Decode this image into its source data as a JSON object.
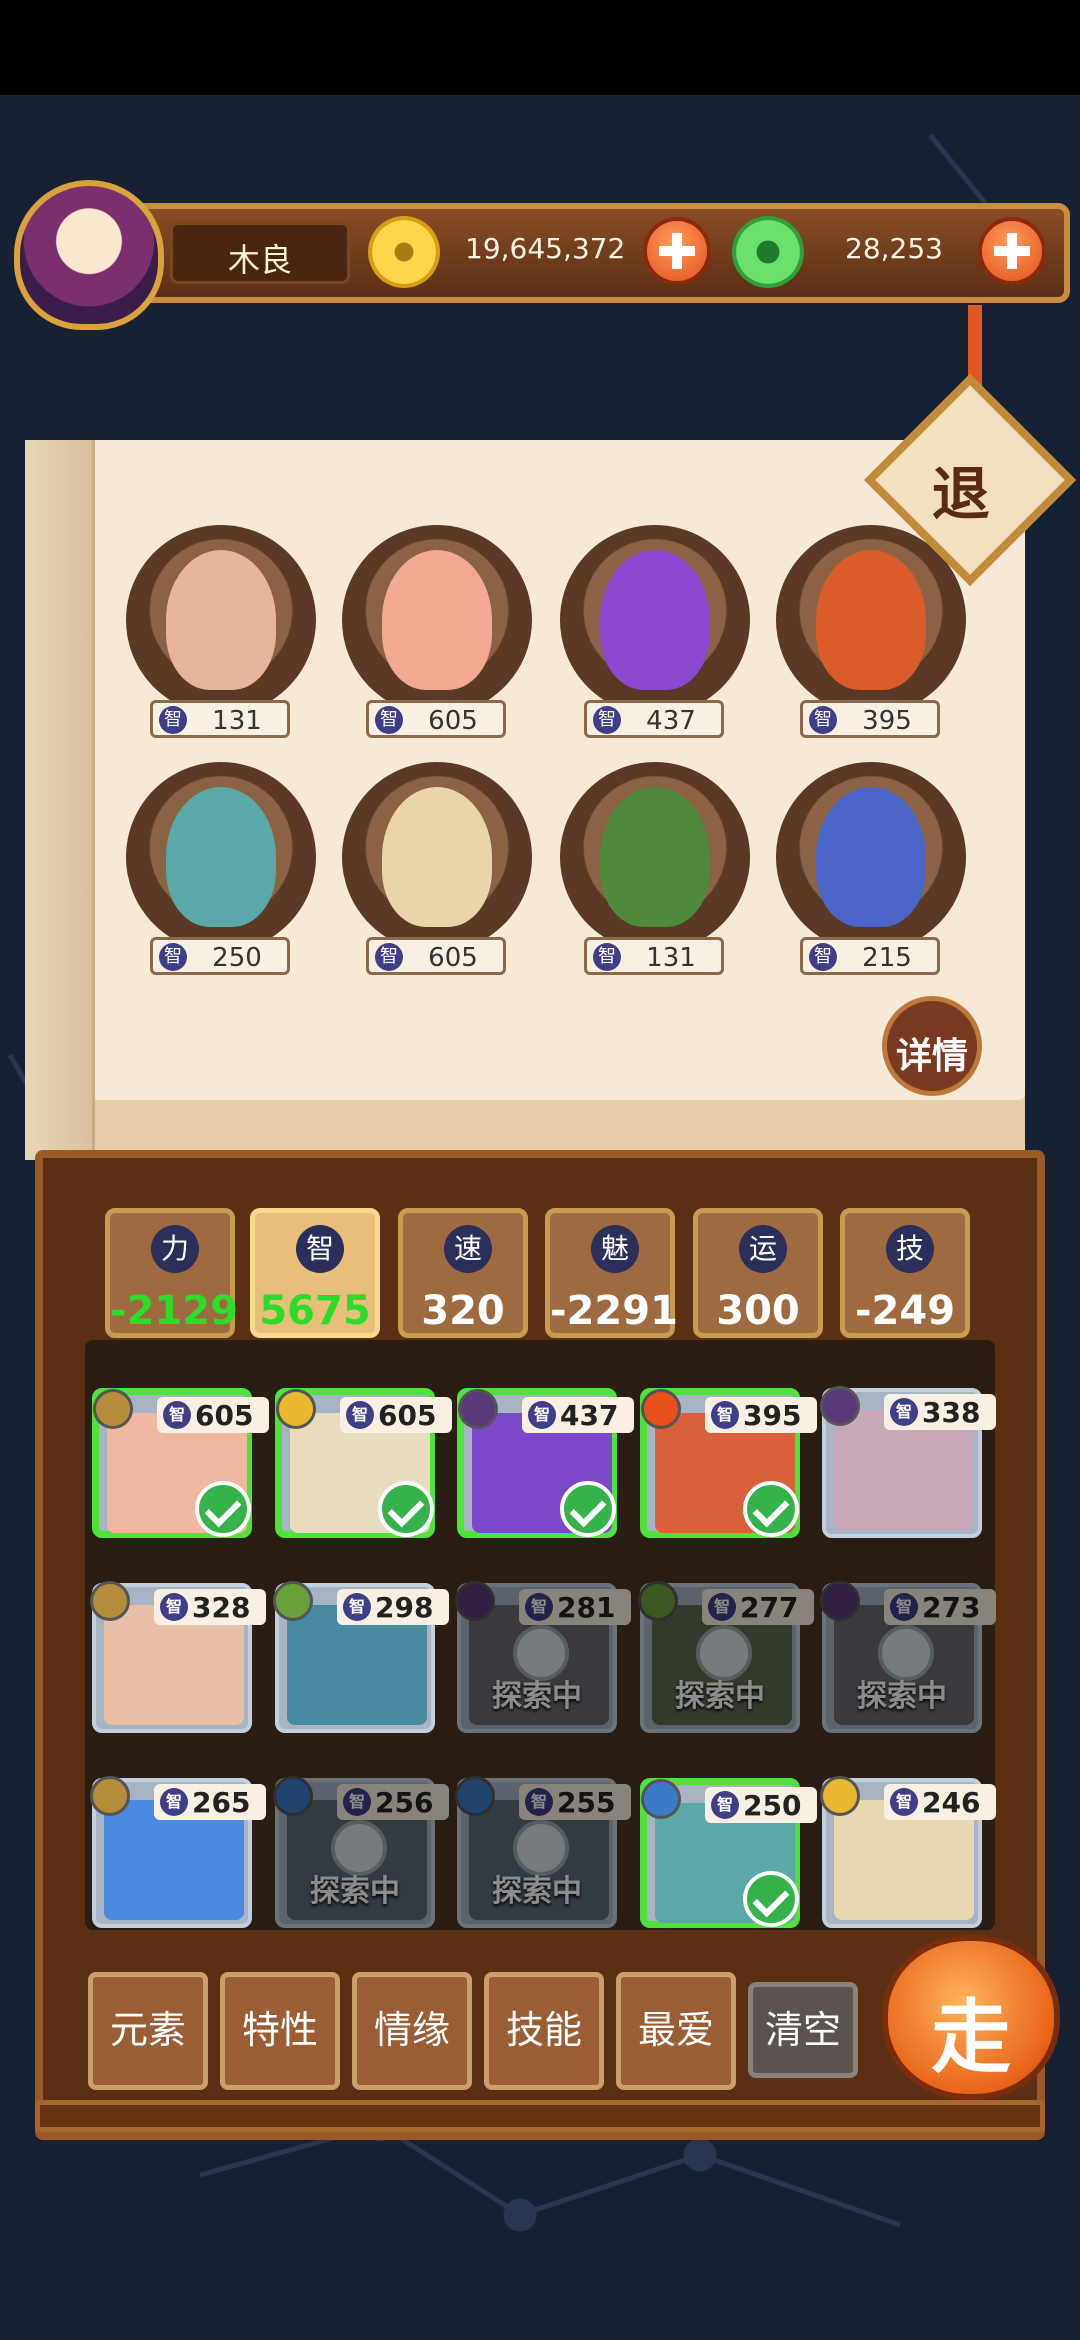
{
  "header": {
    "player_name": "木良",
    "gold": "19,645,372",
    "jade": "28,253"
  },
  "exit_label": "退",
  "detail_label": "详情",
  "selected_heroes": [
    {
      "stat": "智",
      "value": "131",
      "color": "#e8b49a"
    },
    {
      "stat": "智",
      "value": "605",
      "color": "#f2a891"
    },
    {
      "stat": "智",
      "value": "437",
      "color": "#8a48d0"
    },
    {
      "stat": "智",
      "value": "395",
      "color": "#d95c2a"
    },
    {
      "stat": "智",
      "value": "250",
      "color": "#5aa8a8"
    },
    {
      "stat": "智",
      "value": "605",
      "color": "#e8d6a8"
    },
    {
      "stat": "智",
      "value": "131",
      "color": "#4f8a3a"
    },
    {
      "stat": "智",
      "value": "215",
      "color": "#4a64c8"
    }
  ],
  "stats": [
    {
      "icon": "力",
      "value": "-2129",
      "color": "#2bdc2b",
      "selected": false
    },
    {
      "icon": "智",
      "value": "5675",
      "color": "#2bdc2b",
      "selected": true
    },
    {
      "icon": "速",
      "value": "320",
      "color": "#ffffff",
      "selected": false
    },
    {
      "icon": "魅",
      "value": "-2291",
      "color": "#ffffff",
      "selected": false
    },
    {
      "icon": "运",
      "value": "300",
      "color": "#ffffff",
      "selected": false
    },
    {
      "icon": "技",
      "value": "-249",
      "color": "#ffffff",
      "selected": false
    }
  ],
  "roster": [
    {
      "stat": "智",
      "value": "605",
      "state": "selected",
      "elem": "#b48c3a",
      "color": "#f0b8a0"
    },
    {
      "stat": "智",
      "value": "605",
      "state": "selected",
      "elem": "#e8b830",
      "color": "#e8dcc0"
    },
    {
      "stat": "智",
      "value": "437",
      "state": "selected",
      "elem": "#5a3a7a",
      "color": "#7a48c8"
    },
    {
      "stat": "智",
      "value": "395",
      "state": "selected",
      "elem": "#e8501c",
      "color": "#d8603a"
    },
    {
      "stat": "智",
      "value": "338",
      "state": "normal",
      "elem": "#5a3a7a",
      "color": "#c7a8b8"
    },
    {
      "stat": "智",
      "value": "328",
      "state": "normal",
      "elem": "#b48c3a",
      "color": "#e8c0a8"
    },
    {
      "stat": "智",
      "value": "298",
      "state": "normal",
      "elem": "#6aa03a",
      "color": "#4a8aa0"
    },
    {
      "stat": "智",
      "value": "281",
      "state": "exploring",
      "elem": "#5a3a7a",
      "color": "#6a6a70"
    },
    {
      "stat": "智",
      "value": "277",
      "state": "exploring",
      "elem": "#6aa03a",
      "color": "#5a6a50"
    },
    {
      "stat": "智",
      "value": "273",
      "state": "exploring",
      "elem": "#5a3a7a",
      "color": "#6a6a70"
    },
    {
      "stat": "智",
      "value": "265",
      "state": "normal",
      "elem": "#b48c3a",
      "color": "#4a8ae0"
    },
    {
      "stat": "智",
      "value": "256",
      "state": "exploring",
      "elem": "#3a7ac8",
      "color": "#5a6a78"
    },
    {
      "stat": "智",
      "value": "255",
      "state": "exploring",
      "elem": "#3a7ac8",
      "color": "#5a6a78"
    },
    {
      "stat": "智",
      "value": "250",
      "state": "selected",
      "elem": "#3a7ac8",
      "color": "#5aa8a8"
    },
    {
      "stat": "智",
      "value": "246",
      "state": "normal",
      "elem": "#e8b830",
      "color": "#e8d8b0"
    }
  ],
  "exploring_label": "探索中",
  "filters": [
    "元素",
    "特性",
    "情缘",
    "技能",
    "最爱"
  ],
  "clear_label": "清空",
  "go_label": "走"
}
